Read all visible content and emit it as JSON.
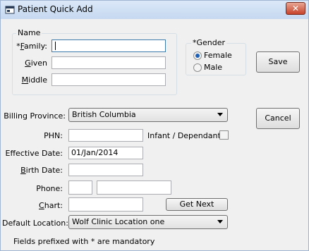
{
  "window": {
    "title": "Patient Quick Add",
    "close_label": "✕"
  },
  "name_group": {
    "label": "Name",
    "family_prefix": "*",
    "family_accel": "F",
    "family_rest": "amily:",
    "family_value": "",
    "given_accel": "G",
    "given_rest": "iven",
    "given_value": "",
    "middle_accel": "M",
    "middle_rest": "iddle",
    "middle_value": ""
  },
  "gender_group": {
    "label": "*Gender",
    "options": [
      {
        "label": "Female",
        "selected": true
      },
      {
        "label": "Male",
        "selected": false
      }
    ]
  },
  "buttons": {
    "save": "Save",
    "cancel": "Cancel",
    "get_next": "Get Next"
  },
  "billing": {
    "label": "Billing Province:",
    "value": "British Columbia"
  },
  "phn": {
    "label": "PHN:",
    "value": ""
  },
  "infant": {
    "label": "Infant / Dependant",
    "checked": false
  },
  "effective_date": {
    "label": "Effective Date:",
    "value": "01/Jan/2014"
  },
  "birth_date": {
    "label_accel": "B",
    "label_rest": "irth Date:",
    "value": ""
  },
  "phone": {
    "label": "Phone:",
    "area_value": "",
    "number_value": ""
  },
  "chart": {
    "label_accel": "C",
    "label_rest": "hart:",
    "value": ""
  },
  "default_location": {
    "label": "Default Location:",
    "value": "Wolf Clinic Location one"
  },
  "footer": {
    "note": "Fields prefixed with * are mandatory"
  }
}
